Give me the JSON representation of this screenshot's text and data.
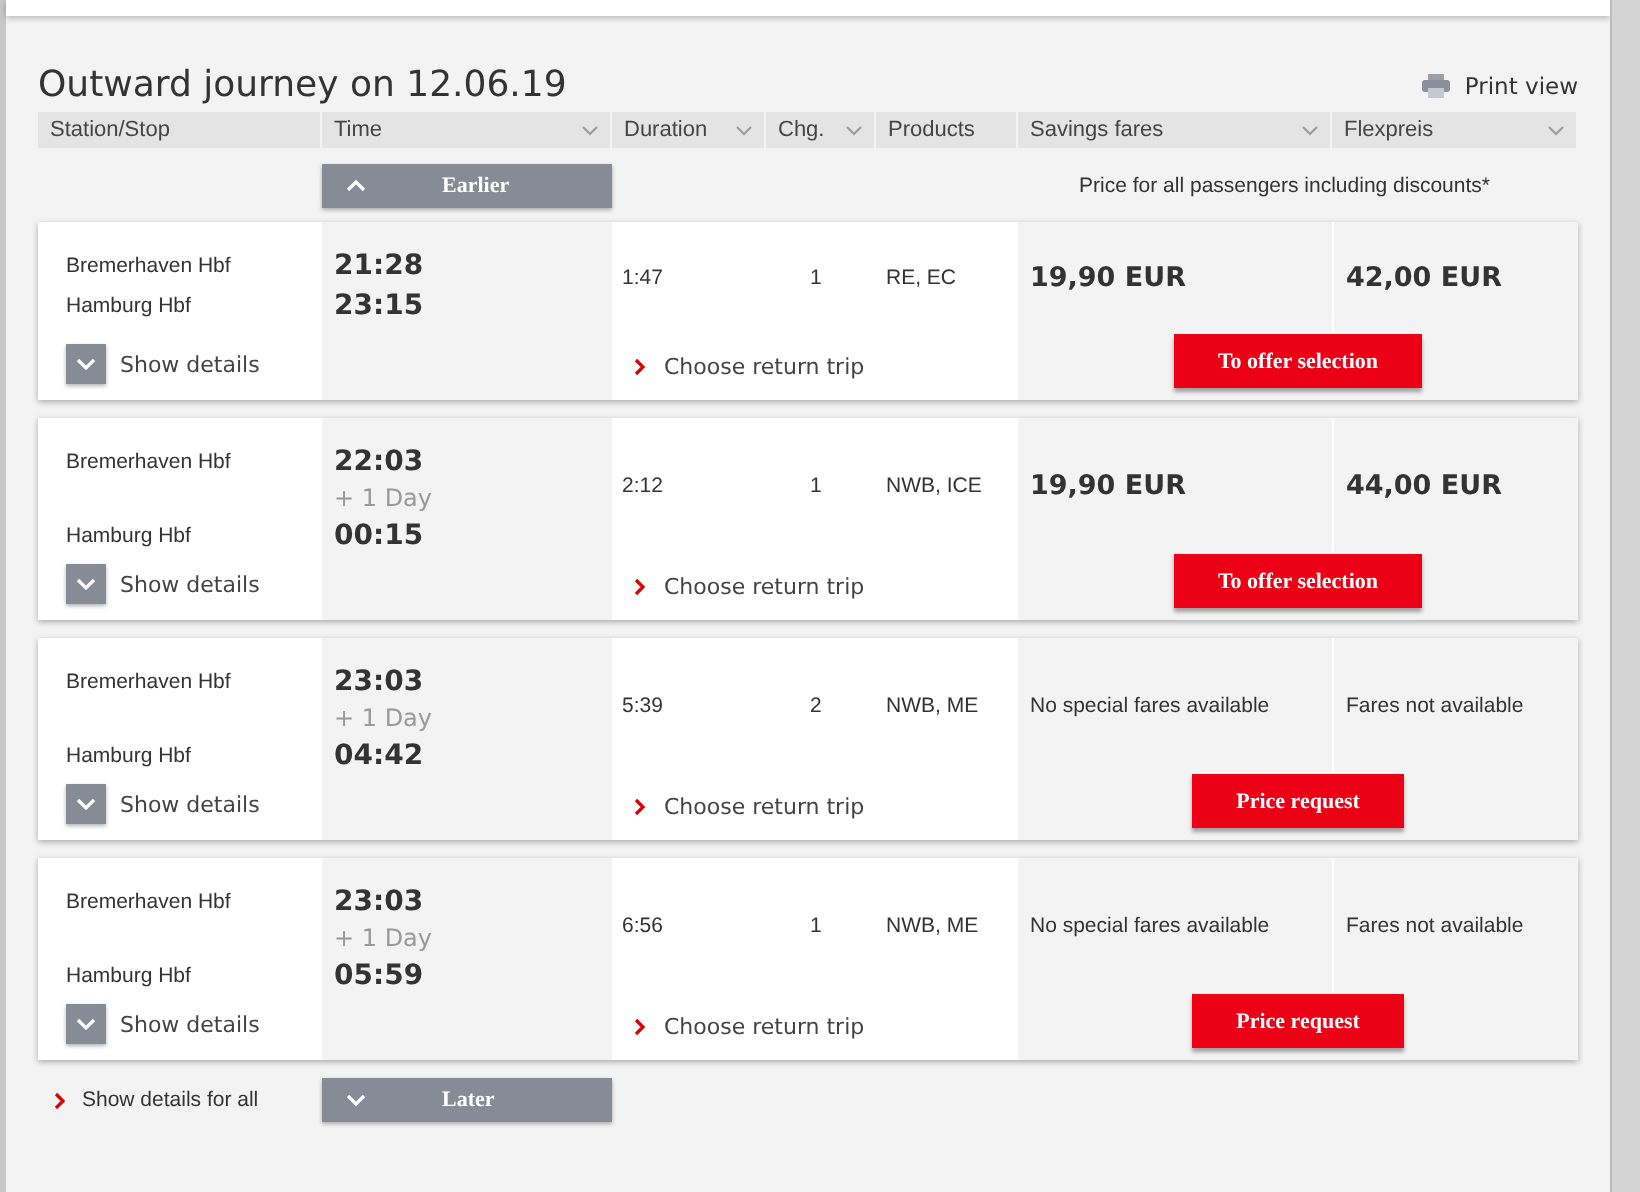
{
  "title": "Outward journey on 12.06.19",
  "print_view": "Print view",
  "columns": [
    {
      "label": "Station/Stop",
      "sortable": false
    },
    {
      "label": "Time",
      "sortable": true
    },
    {
      "label": "Duration",
      "sortable": true
    },
    {
      "label": "Chg.",
      "sortable": true
    },
    {
      "label": "Products",
      "sortable": false
    },
    {
      "label": "Savings fares",
      "sortable": true
    },
    {
      "label": "Flexpreis",
      "sortable": true
    }
  ],
  "earlier_button": "Earlier",
  "price_note": "Price for all passengers including discounts*",
  "connections": [
    {
      "from": "Bremerhaven Hbf",
      "to": "Hamburg Hbf",
      "departure": "21:28",
      "arrival": "23:15",
      "duration": "1:47",
      "changes": "1",
      "products": "RE, EC",
      "savings": {
        "kind": "price",
        "text": "19,90 EUR"
      },
      "flex": {
        "kind": "price",
        "text": "42,00 EUR"
      },
      "action": "To offer selection",
      "show_details": "Show details",
      "return_trip": "Choose return trip"
    },
    {
      "from": "Bremerhaven Hbf",
      "to": "Hamburg Hbf",
      "departure": "22:03",
      "next_day": "+ 1 Day",
      "arrival": "00:15",
      "duration": "2:12",
      "changes": "1",
      "products": "NWB, ICE",
      "savings": {
        "kind": "price",
        "text": "19,90 EUR"
      },
      "flex": {
        "kind": "price",
        "text": "44,00 EUR"
      },
      "action": "To offer selection",
      "show_details": "Show details",
      "return_trip": "Choose return trip"
    },
    {
      "from": "Bremerhaven Hbf",
      "to": "Hamburg Hbf",
      "departure": "23:03",
      "next_day": "+ 1 Day",
      "arrival": "04:42",
      "duration": "5:39",
      "changes": "2",
      "products": "NWB, ME",
      "savings": {
        "kind": "note",
        "text": "No special fares available"
      },
      "flex": {
        "kind": "note",
        "text": "Fares not available"
      },
      "action": "Price request",
      "show_details": "Show details",
      "return_trip": "Choose return trip"
    },
    {
      "from": "Bremerhaven Hbf",
      "to": "Hamburg Hbf",
      "departure": "23:03",
      "next_day": "+ 1 Day",
      "arrival": "05:59",
      "duration": "6:56",
      "changes": "1",
      "products": "NWB, ME",
      "savings": {
        "kind": "note",
        "text": "No special fares available"
      },
      "flex": {
        "kind": "note",
        "text": "Fares not available"
      },
      "action": "Price request",
      "show_details": "Show details",
      "return_trip": "Choose return trip"
    }
  ],
  "show_details_all": "Show details for all",
  "later_button": "Later"
}
